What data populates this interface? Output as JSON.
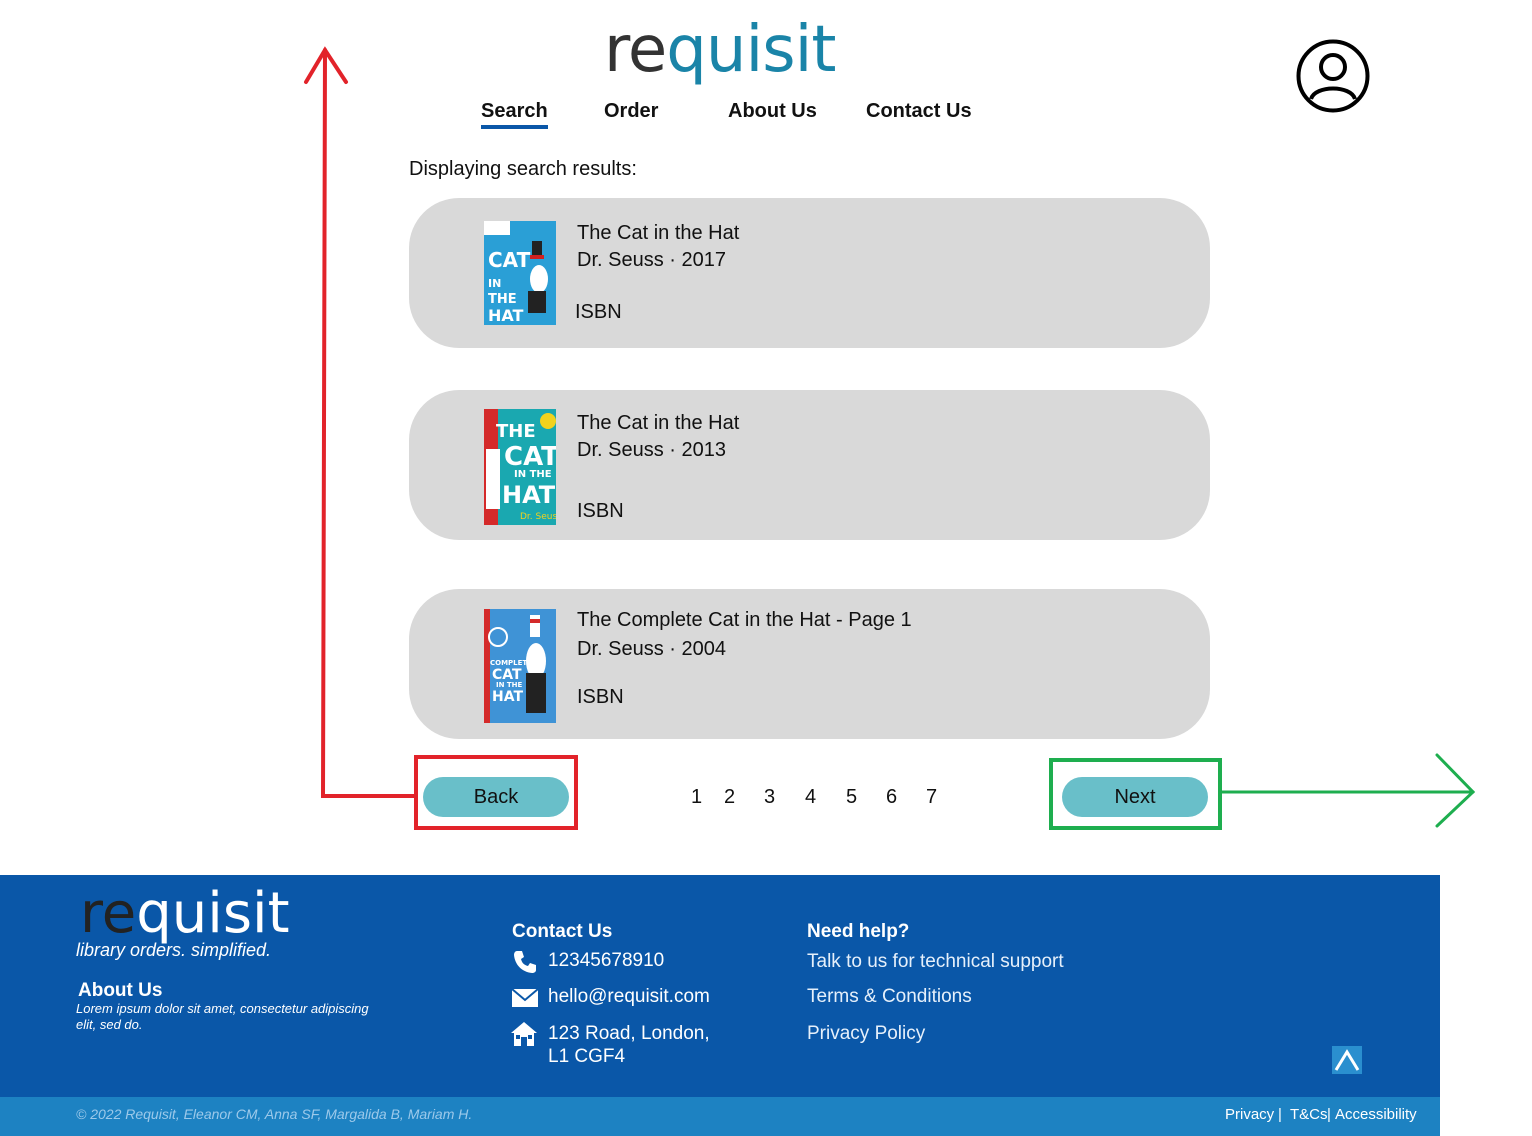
{
  "header": {
    "logo": {
      "part1": "re",
      "part2": "quisit"
    },
    "nav": [
      {
        "label": "Search",
        "active": true
      },
      {
        "label": "Order",
        "active": false
      },
      {
        "label": "About Us",
        "active": false
      },
      {
        "label": "Contact Us",
        "active": false
      }
    ],
    "profile_icon": "user-circle-icon"
  },
  "results": {
    "heading": "Displaying search results:",
    "items": [
      {
        "title": "The Cat in the Hat",
        "meta": "Dr. Seuss · 2017",
        "isbn": "ISBN",
        "cover": "cat-in-the-hat-cover-2017"
      },
      {
        "title": "The Cat in the Hat",
        "meta": "Dr. Seuss · 2013",
        "isbn": "ISBN",
        "cover": "cat-in-the-hat-cover-2013"
      },
      {
        "title": "The Complete Cat in the Hat - Page 1",
        "meta": "Dr. Seuss · 2004",
        "isbn": "ISBN",
        "cover": "complete-cat-in-the-hat-cover"
      }
    ]
  },
  "pagination": {
    "back_label": "Back",
    "next_label": "Next",
    "pages": [
      "1",
      "2",
      "3",
      "4",
      "5",
      "6",
      "7"
    ]
  },
  "annotations": {
    "back_arrow_color": "#e2232a",
    "next_arrow_color": "#1eae4f"
  },
  "footer": {
    "logo": {
      "part1": "re",
      "part2": "quisit"
    },
    "tagline": "library orders. simplified.",
    "about_heading": "About Us",
    "about_text": "Lorem ipsum dolor sit amet, consectetur adipiscing elit, sed do.",
    "contact_heading": "Contact Us",
    "phone": "12345678910",
    "email": "hello@requisit.com",
    "address_line1": "123 Road, London,",
    "address_line2": "L1 CGF4",
    "help_heading": "Need help?",
    "help_links": [
      "Talk to us for technical support",
      "Terms & Conditions",
      "Privacy Policy"
    ],
    "copyright": "© 2022 Requisit, Eleanor CM, Anna SF, Margalida B, Mariam H.",
    "legal": {
      "privacy": "Privacy",
      "terms": "T&Cs",
      "accessibility": "Accessibility",
      "sep": "|"
    },
    "colors": {
      "primary": "#0a57a8",
      "bar": "#1d82c2"
    }
  }
}
